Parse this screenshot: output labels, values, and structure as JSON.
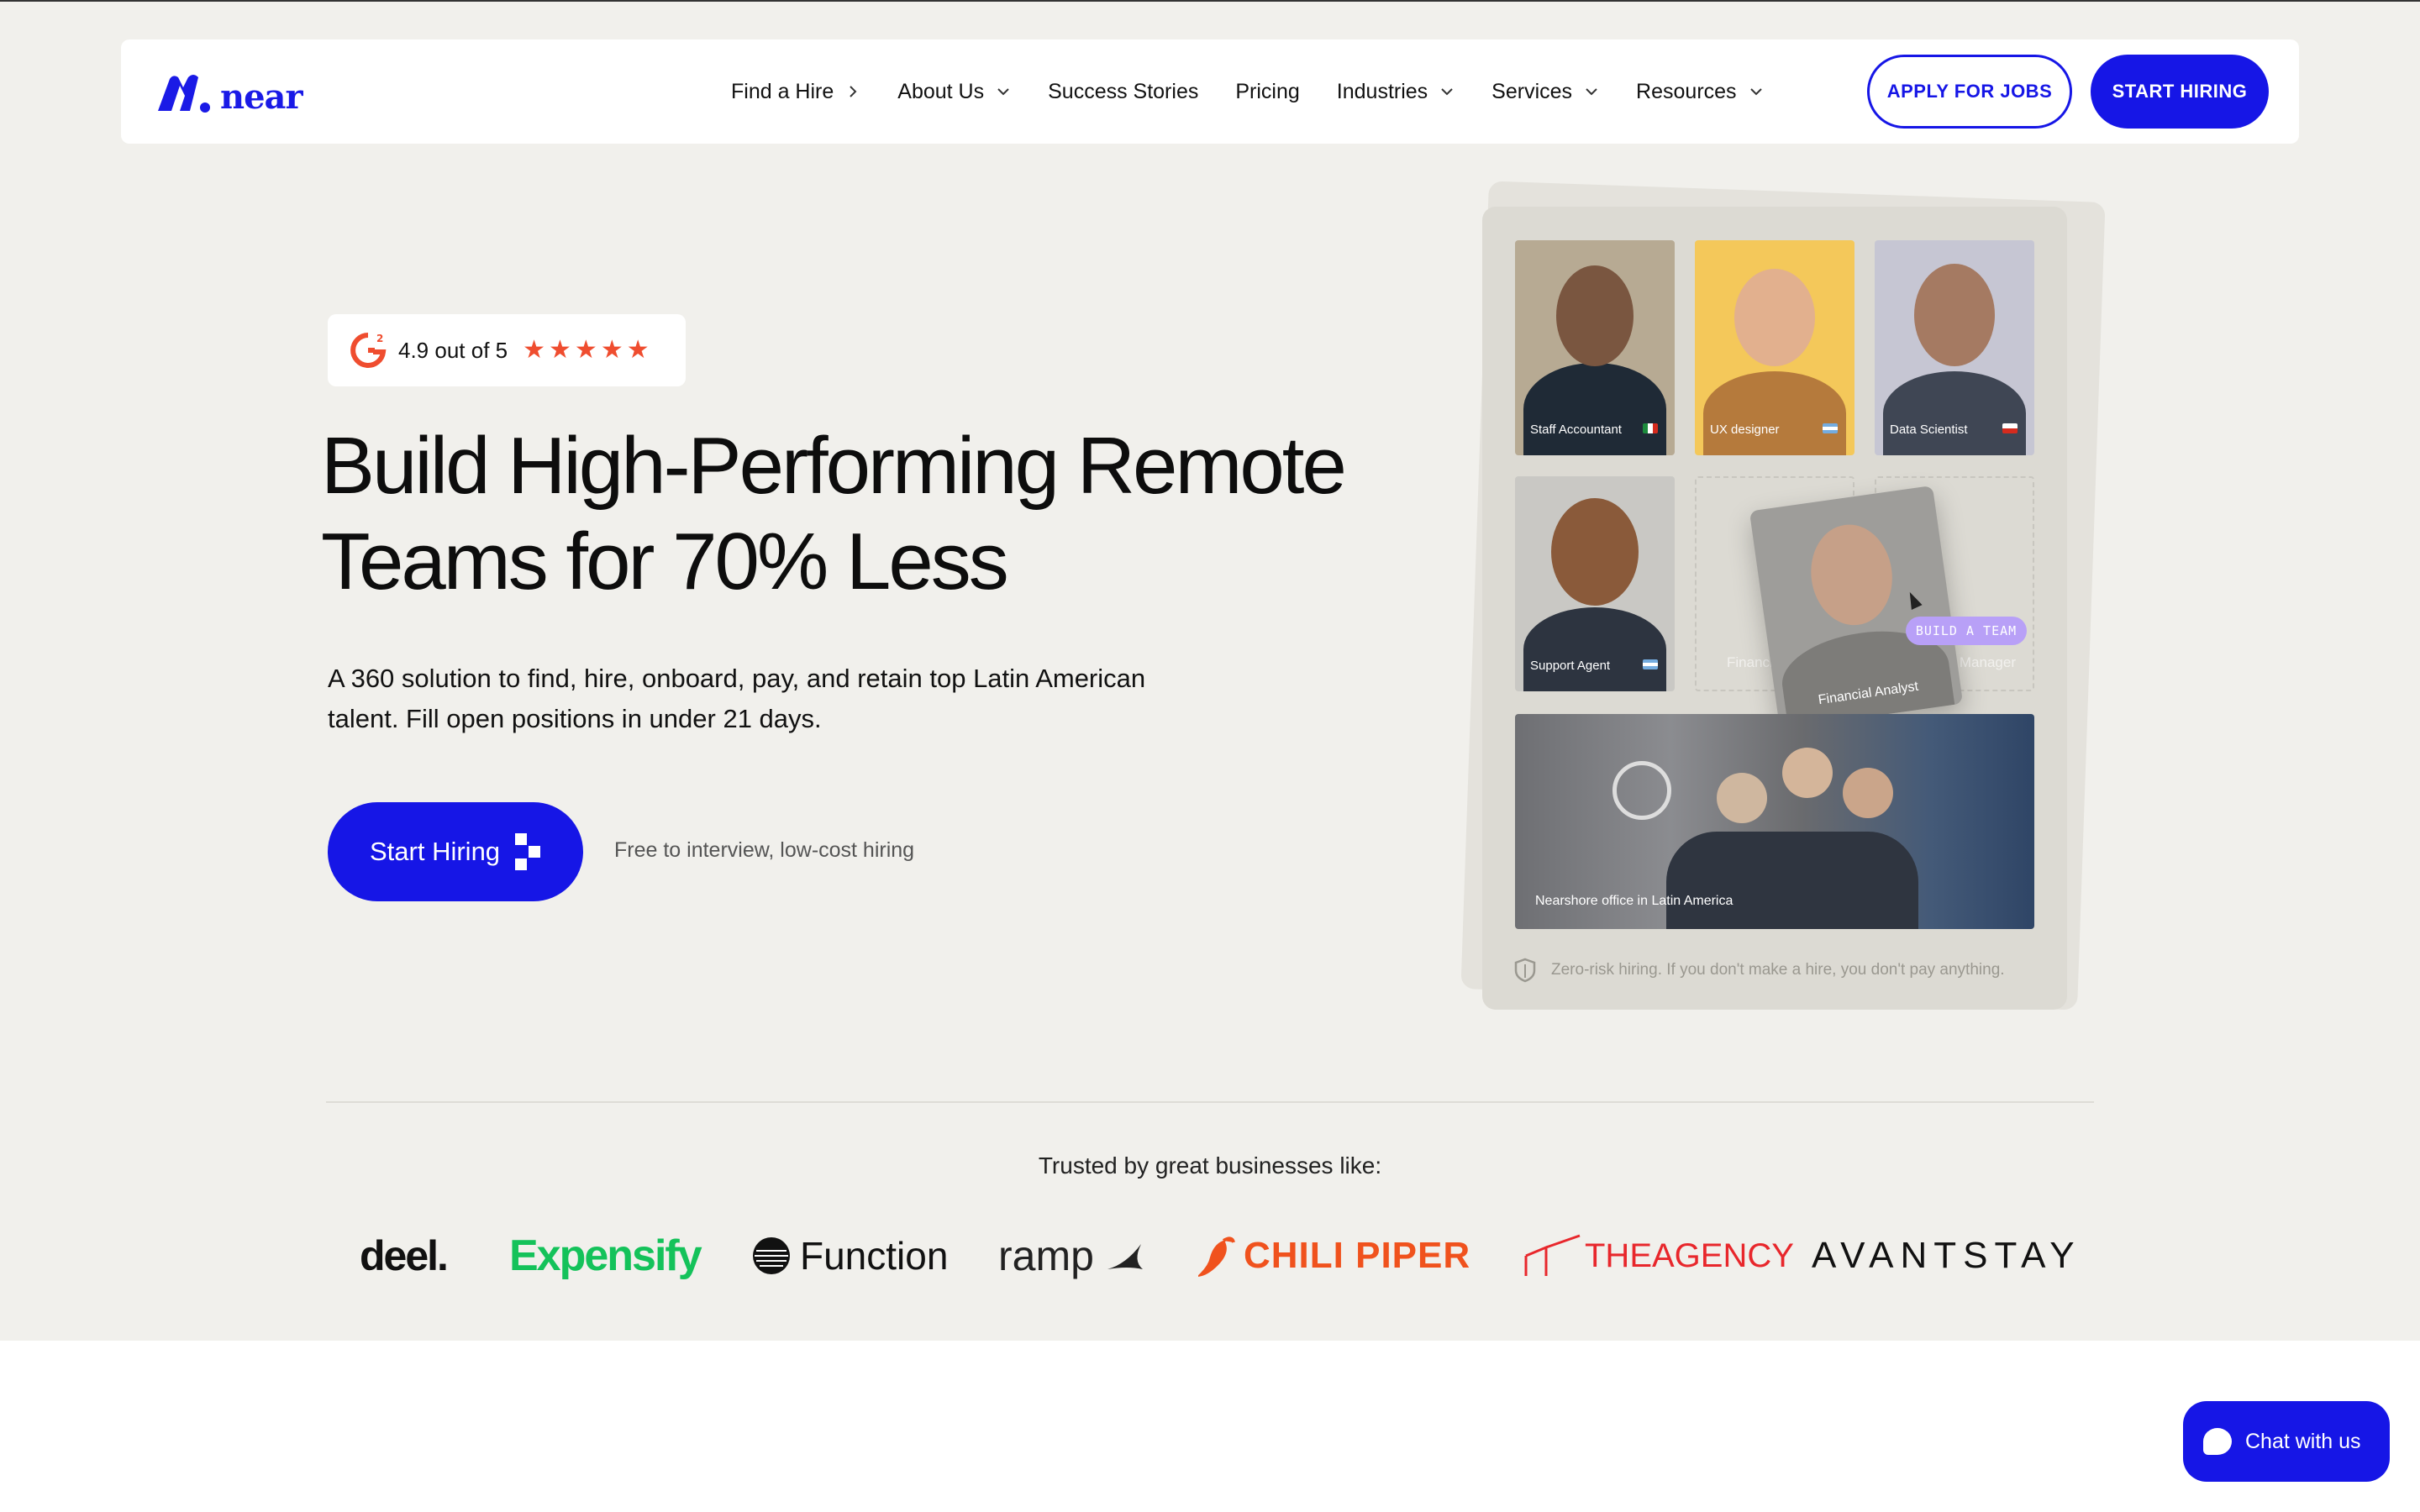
{
  "nav": {
    "logo_text": "near",
    "items": [
      {
        "label": "Find a Hire",
        "chevron": "right"
      },
      {
        "label": "About Us",
        "chevron": "down"
      },
      {
        "label": "Success Stories",
        "chevron": ""
      },
      {
        "label": "Pricing",
        "chevron": ""
      },
      {
        "label": "Industries",
        "chevron": "down"
      },
      {
        "label": "Services",
        "chevron": "down"
      },
      {
        "label": "Resources",
        "chevron": "down"
      }
    ],
    "apply_label": "APPLY FOR JOBS",
    "start_label": "START HIRING"
  },
  "hero": {
    "rating_text": "4.9 out of 5",
    "rating_stars": 5,
    "headline_line1": "Build High-Performing Remote",
    "headline_line2": "Teams for 70% Less",
    "subtext": "A 360 solution to find, hire, onboard, pay, and retain top Latin American talent. Fill open positions in under 21 days.",
    "cta_label": "Start Hiring",
    "cta_note": "Free to interview, low-cost hiring"
  },
  "collage": {
    "tiles": [
      {
        "label": "Staff Accountant"
      },
      {
        "label": "UX designer"
      },
      {
        "label": "Data Scientist"
      },
      {
        "label": "Support Agent"
      }
    ],
    "ghost_left": "Financia",
    "ghost_right": "Manager",
    "floater_label": "Financial Analyst",
    "tag": "BUILD A TEAM",
    "office_label": "Nearshore office in Latin America",
    "zero_risk": "Zero-risk hiring. If you don't make a hire, you don't pay anything."
  },
  "trusted": {
    "title": "Trusted by great businesses like:",
    "logos": [
      "deel.",
      "Expensify",
      "Function",
      "ramp",
      "CHILI PIPER",
      "THEAGENCY",
      "AVANTSTAY"
    ]
  },
  "chat": {
    "label": "Chat with us"
  },
  "colors": {
    "brand": "#1616e6",
    "star": "#ef4d2f",
    "hero_bg": "#f1f0ec",
    "tag": "#b8a0f7"
  }
}
